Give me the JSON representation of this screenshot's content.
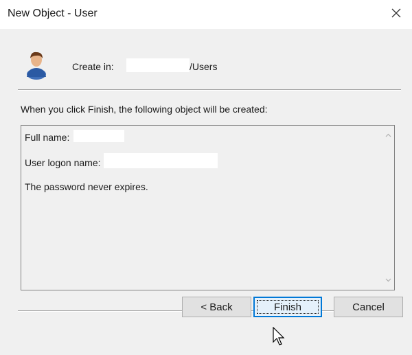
{
  "window": {
    "title": "New Object - User",
    "close_icon": "close-icon"
  },
  "header": {
    "icon": "user-icon",
    "create_in_label": "Create in:",
    "create_in_path": "/Users"
  },
  "summary": {
    "intro": "When you click Finish, the following object will be created:",
    "full_name_label": "Full name:",
    "logon_name_label": "User logon name:",
    "password_note": "The password never expires."
  },
  "buttons": {
    "back": "< Back",
    "finish": "Finish",
    "cancel": "Cancel"
  },
  "colors": {
    "accent": "#0078d7",
    "dialog_bg": "#f0f0f0"
  }
}
